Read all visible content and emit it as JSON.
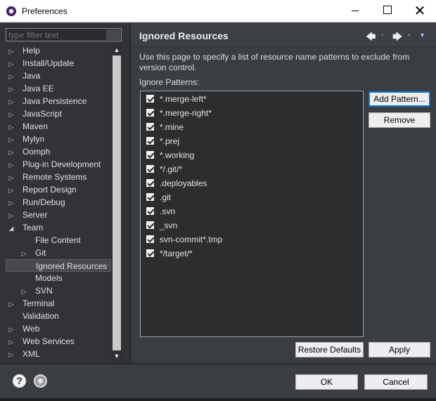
{
  "window": {
    "title": "Preferences",
    "minimize": "",
    "maximize": "",
    "close": "✕"
  },
  "filter": {
    "placeholder": "type filter text"
  },
  "tree": [
    {
      "label": "Help",
      "level": 0,
      "twisty": "▷"
    },
    {
      "label": "Install/Update",
      "level": 0,
      "twisty": "▷"
    },
    {
      "label": "Java",
      "level": 0,
      "twisty": "▷"
    },
    {
      "label": "Java EE",
      "level": 0,
      "twisty": "▷"
    },
    {
      "label": "Java Persistence",
      "level": 0,
      "twisty": "▷"
    },
    {
      "label": "JavaScript",
      "level": 0,
      "twisty": "▷"
    },
    {
      "label": "Maven",
      "level": 0,
      "twisty": "▷"
    },
    {
      "label": "Mylyn",
      "level": 0,
      "twisty": "▷"
    },
    {
      "label": "Oomph",
      "level": 0,
      "twisty": "▷"
    },
    {
      "label": "Plug-in Development",
      "level": 0,
      "twisty": "▷"
    },
    {
      "label": "Remote Systems",
      "level": 0,
      "twisty": "▷"
    },
    {
      "label": "Report Design",
      "level": 0,
      "twisty": "▷"
    },
    {
      "label": "Run/Debug",
      "level": 0,
      "twisty": "▷"
    },
    {
      "label": "Server",
      "level": 0,
      "twisty": "▷"
    },
    {
      "label": "Team",
      "level": 0,
      "twisty": "◢"
    },
    {
      "label": "File Content",
      "level": 1,
      "twisty": ""
    },
    {
      "label": "Git",
      "level": 1,
      "twisty": "▷"
    },
    {
      "label": "Ignored Resources",
      "level": 1,
      "twisty": "",
      "selected": true
    },
    {
      "label": "Models",
      "level": 1,
      "twisty": ""
    },
    {
      "label": "SVN",
      "level": 1,
      "twisty": "▷"
    },
    {
      "label": "Terminal",
      "level": 0,
      "twisty": "▷"
    },
    {
      "label": "Validation",
      "level": 0,
      "twisty": ""
    },
    {
      "label": "Web",
      "level": 0,
      "twisty": "▷"
    },
    {
      "label": "Web Services",
      "level": 0,
      "twisty": "▷"
    },
    {
      "label": "XML",
      "level": 0,
      "twisty": "▷"
    }
  ],
  "page": {
    "title": "Ignored Resources",
    "description": "Use this page to specify a list of resource name patterns to exclude from version control.",
    "patterns_label": "Ignore Patterns:",
    "patterns": [
      {
        "text": "*.merge-left*",
        "checked": true
      },
      {
        "text": "*.merge-right*",
        "checked": true
      },
      {
        "text": "*.mine",
        "checked": true
      },
      {
        "text": "*.prej",
        "checked": true
      },
      {
        "text": "*.working",
        "checked": true
      },
      {
        "text": "*/.git/*",
        "checked": true
      },
      {
        "text": ".deployables",
        "checked": true
      },
      {
        "text": ".git",
        "checked": true
      },
      {
        "text": ".svn",
        "checked": true
      },
      {
        "text": "_svn",
        "checked": true
      },
      {
        "text": "svn-commit*.tmp",
        "checked": true
      },
      {
        "text": "*/target/*",
        "checked": true
      }
    ],
    "add_pattern": "Add Pattern...",
    "remove": "Remove",
    "restore_defaults": "Restore Defaults",
    "apply": "Apply"
  },
  "nav": {
    "back": "🡄",
    "forward": "🡆",
    "menu": "▼",
    "dropdown": "▾"
  },
  "footer": {
    "help": "?",
    "ok": "OK",
    "cancel": "Cancel"
  },
  "scroll": {
    "up": "▲",
    "down": "▼"
  }
}
